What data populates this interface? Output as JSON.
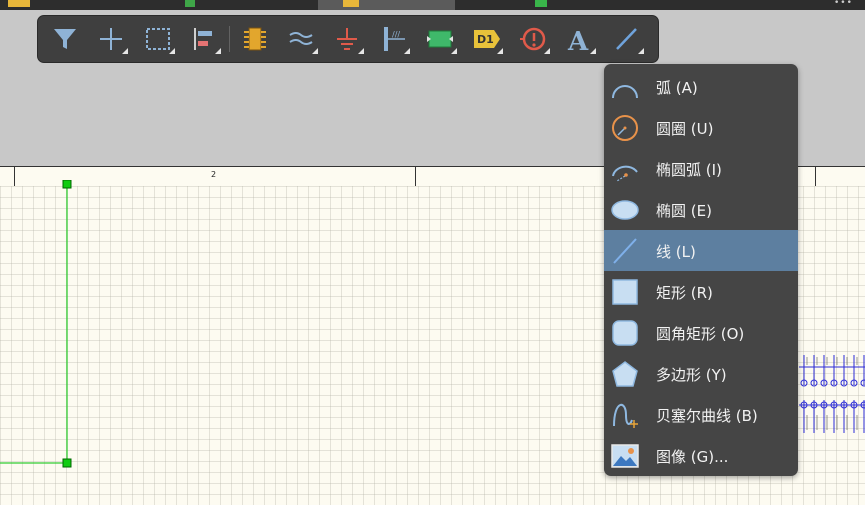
{
  "toolbar": {
    "tools": [
      {
        "name": "filter-icon"
      },
      {
        "name": "move-crosshair-icon"
      },
      {
        "name": "select-rectangle-icon"
      },
      {
        "name": "align-icon"
      },
      {
        "name": "part-icon"
      },
      {
        "name": "harness-icon"
      },
      {
        "name": "power-port-ground-icon"
      },
      {
        "name": "port-icon"
      },
      {
        "name": "sheet-symbol-icon"
      },
      {
        "name": "designator-tag-icon",
        "label": "D1"
      },
      {
        "name": "directive-icon"
      },
      {
        "name": "text-icon",
        "label": "A"
      },
      {
        "name": "line-tool-icon"
      }
    ]
  },
  "ruler": {
    "zone_label": "2"
  },
  "shape_menu": {
    "items": [
      {
        "name": "arc",
        "label": "弧 (A)"
      },
      {
        "name": "full-circle",
        "label": "圆圈 (U)"
      },
      {
        "name": "elliptical-arc",
        "label": "椭圆弧 (I)"
      },
      {
        "name": "ellipse",
        "label": "椭圆 (E)"
      },
      {
        "name": "line",
        "label": "线 (L)",
        "selected": true
      },
      {
        "name": "rectangle",
        "label": "矩形 (R)"
      },
      {
        "name": "round-rectangle",
        "label": "圆角矩形 (O)"
      },
      {
        "name": "polygon",
        "label": "多边形 (Y)"
      },
      {
        "name": "bezier",
        "label": "贝塞尔曲线 (B)"
      },
      {
        "name": "image",
        "label": "图像 (G)..."
      }
    ]
  },
  "colors": {
    "menu_bg": "#454545",
    "menu_selected": "#5d7fa0",
    "toolbar_bg": "#3f3f3f",
    "sheet_bg": "#fdfbf1",
    "selection_green": "#00cc00",
    "component_blue": "#2b2bd6"
  }
}
